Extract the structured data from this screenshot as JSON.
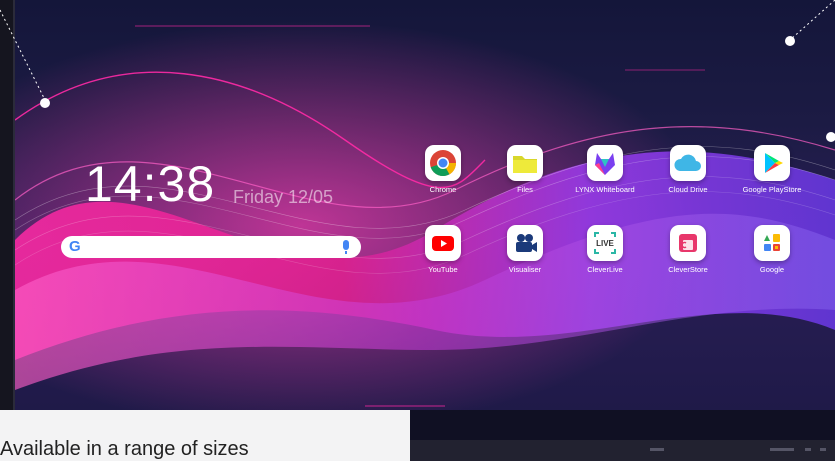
{
  "home": {
    "time": "14:38",
    "date": "Friday 12/05"
  },
  "search": {
    "logo": "G",
    "icon": "mic-icon"
  },
  "apps": [
    {
      "label": "Chrome",
      "icon": "chrome-icon"
    },
    {
      "label": "Files",
      "icon": "folder-icon"
    },
    {
      "label": "LYNX Whiteboard",
      "icon": "lynx-whiteboard-icon"
    },
    {
      "label": "Cloud Drive",
      "icon": "cloud-icon"
    },
    {
      "label": "Google PlayStore",
      "icon": "play-store-icon"
    },
    {
      "label": "YouTube",
      "icon": "youtube-icon"
    },
    {
      "label": "Visualiser",
      "icon": "camera-icon"
    },
    {
      "label": "CleverLive",
      "icon": "live-icon",
      "badge": "LIVE"
    },
    {
      "label": "CleverStore",
      "icon": "store-icon"
    },
    {
      "label": "Google",
      "icon": "google-apps-icon"
    }
  ],
  "caption": "Available in a range of sizes",
  "colors": {
    "accent": "#e0208f",
    "violet": "#8a3df2",
    "bg": "#1c1b44"
  }
}
